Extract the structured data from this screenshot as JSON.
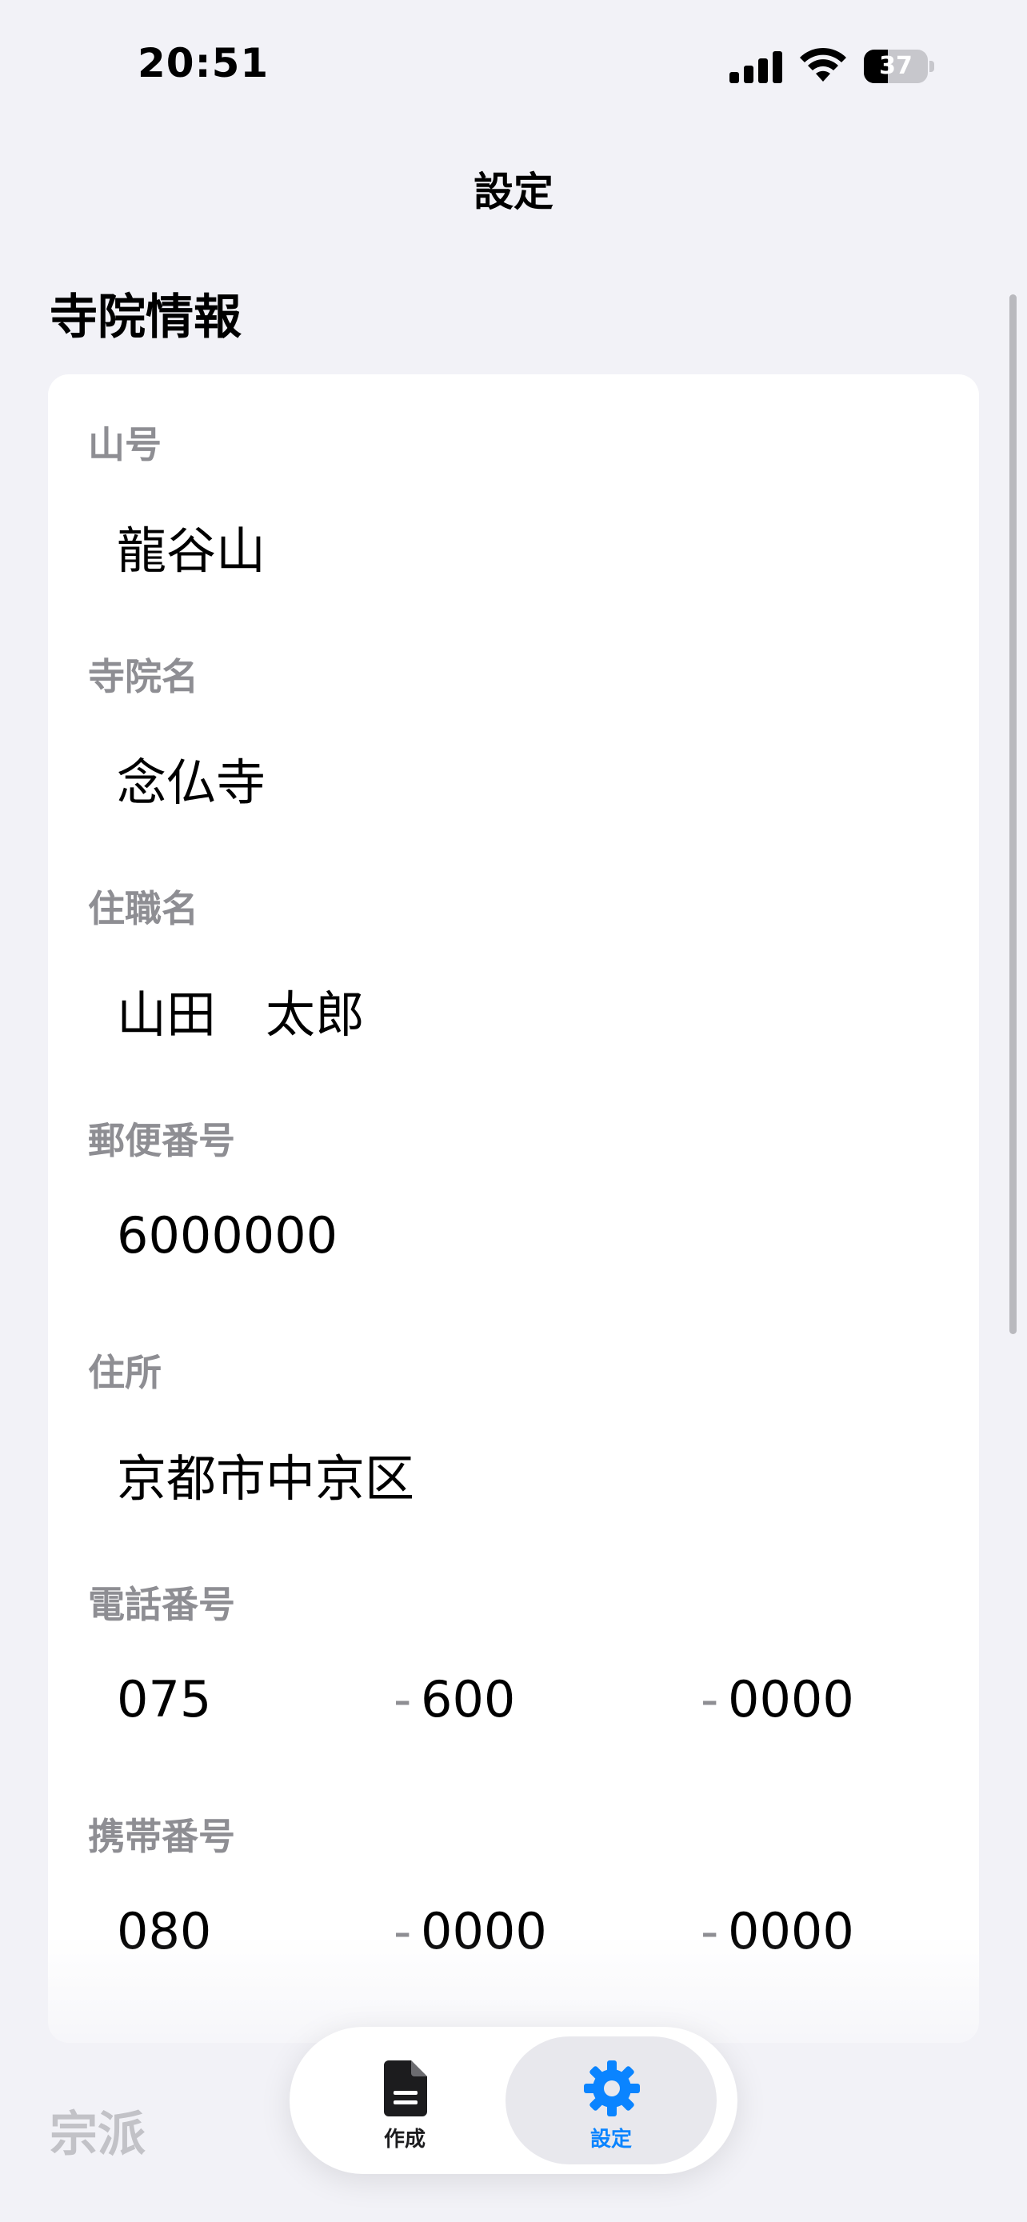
{
  "status_bar": {
    "time": "20:51",
    "battery_percent": 37,
    "battery_label": "37"
  },
  "nav": {
    "title": "設定"
  },
  "temple_section": {
    "title": "寺院情報",
    "fields": {
      "sango": {
        "label": "山号",
        "value": "龍谷山"
      },
      "temple_name": {
        "label": "寺院名",
        "value": "念仏寺"
      },
      "chief_priest": {
        "label": "住職名",
        "value": "山田　太郎"
      },
      "postal_code": {
        "label": "郵便番号",
        "value": "6000000"
      },
      "address": {
        "label": "住所",
        "value": "京都市中京区"
      },
      "phone": {
        "label": "電話番号",
        "part1": "075",
        "part2": "600",
        "part3": "0000",
        "separator": "-"
      },
      "mobile": {
        "label": "携帯番号",
        "part1": "080",
        "part2": "0000",
        "part3": "0000",
        "separator": "-"
      }
    }
  },
  "next_section": {
    "title": "宗派"
  },
  "tab_bar": {
    "create_label": "作成",
    "settings_label": "設定",
    "active_tab": "settings",
    "active_color": "#0a84ff",
    "inactive_color": "#1c1c1e",
    "create_icon": "document-icon",
    "settings_icon": "gear-icon"
  }
}
